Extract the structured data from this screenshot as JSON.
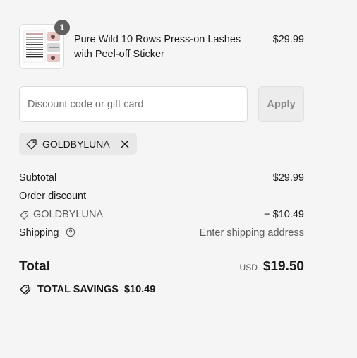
{
  "line_item": {
    "quantity": "1",
    "name": "Pure Wild 10 Rows Press-on Lashes with Peel-off Sticker",
    "price": "$29.99",
    "image_icon": "product-thumbnail"
  },
  "discount": {
    "placeholder": "Discount code or gift card",
    "value": "",
    "apply_label": "Apply",
    "applied_code": "GOLDBYLUNA"
  },
  "summary": {
    "subtotal_label": "Subtotal",
    "subtotal_value": "$29.99",
    "order_discount_label": "Order discount",
    "discount_code": "GOLDBYLUNA",
    "discount_value": "− $10.49",
    "shipping_label": "Shipping",
    "shipping_value": "Enter shipping address",
    "total_label": "Total",
    "currency": "USD",
    "total_value": "$19.50",
    "savings_label": "TOTAL SAVINGS",
    "savings_value": "$10.49"
  },
  "colors": {
    "background": "#f5f5f5",
    "badge": "#5f5f5f",
    "apply_disabled_text": "#8a8a8a",
    "chip_bg": "#e8e8e8"
  }
}
